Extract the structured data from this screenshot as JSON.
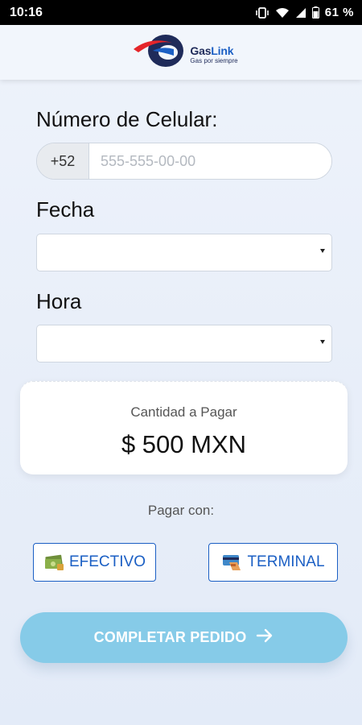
{
  "status_bar": {
    "time": "10:16",
    "battery": "61 %",
    "icons": [
      "vibrate-icon",
      "wifi-icon",
      "signal-icon",
      "battery-icon"
    ]
  },
  "header": {
    "logo_name_part1": "Gas",
    "logo_name_part2": "Link",
    "logo_tagline": "Gas por siempre"
  },
  "form": {
    "phone_label": "Número de Celular:",
    "phone_prefix": "+52",
    "phone_placeholder": "555-555-00-00",
    "phone_value": "",
    "date_label": "Fecha",
    "date_value": "",
    "time_label": "Hora",
    "time_value": ""
  },
  "amount": {
    "label": "Cantidad a Pagar",
    "value": "$ 500 MXN"
  },
  "payment": {
    "title": "Pagar con:",
    "cash_label": "EFECTIVO",
    "terminal_label": "TERMINAL"
  },
  "submit": {
    "label": "COMPLETAR PEDIDO"
  },
  "colors": {
    "primary": "#1b5fc4",
    "submit": "#86cbe8",
    "logo_red": "#e5252a",
    "logo_navy": "#1f2b5a"
  }
}
